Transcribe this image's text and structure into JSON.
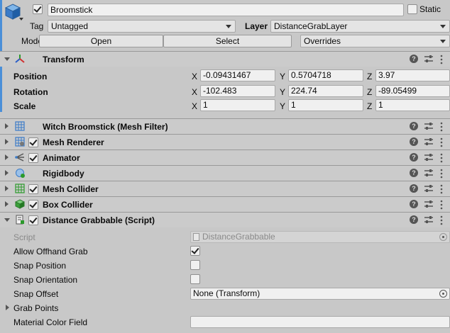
{
  "header": {
    "name": "Broomstick",
    "static_label": "Static",
    "tag_label": "Tag",
    "tag_value": "Untagged",
    "layer_label": "Layer",
    "layer_value": "DistanceGrabLayer",
    "model_label": "Model",
    "open_label": "Open",
    "select_label": "Select",
    "overrides_label": "Overrides"
  },
  "transform": {
    "title": "Transform",
    "rows": [
      {
        "label": "Position",
        "x": "-0.09431467",
        "y": "0.5704718",
        "z": "3.97"
      },
      {
        "label": "Rotation",
        "x": "-102.483",
        "y": "224.74",
        "z": "-89.05499"
      },
      {
        "label": "Scale",
        "x": "1",
        "y": "1",
        "z": "1"
      }
    ],
    "axis_x": "X",
    "axis_y": "Y",
    "axis_z": "Z"
  },
  "components": [
    {
      "title": "Witch Broomstick (Mesh Filter)",
      "icon": "mesh-filter-icon",
      "checkbox": false
    },
    {
      "title": "Mesh Renderer",
      "icon": "mesh-renderer-icon",
      "checkbox": true
    },
    {
      "title": "Animator",
      "icon": "animator-icon",
      "checkbox": true
    },
    {
      "title": "Rigidbody",
      "icon": "rigidbody-icon",
      "checkbox": false
    },
    {
      "title": "Mesh Collider",
      "icon": "mesh-collider-icon",
      "checkbox": true
    },
    {
      "title": "Box Collider",
      "icon": "box-collider-icon",
      "checkbox": true
    },
    {
      "title": "Distance Grabbable (Script)",
      "icon": "script-icon",
      "checkbox": true
    }
  ],
  "script": {
    "script_label": "Script",
    "script_value": "DistanceGrabbable",
    "allow_offhand_label": "Allow Offhand Grab",
    "allow_offhand_checked": true,
    "snap_position_label": "Snap Position",
    "snap_position_checked": false,
    "snap_orientation_label": "Snap Orientation",
    "snap_orientation_checked": false,
    "snap_offset_label": "Snap Offset",
    "snap_offset_value": "None (Transform)",
    "grab_points_label": "Grab Points",
    "material_color_label": "Material Color Field",
    "material_color_value": ""
  },
  "colors": {
    "accent": "#4a8fd8",
    "panel": "#c8c8c8",
    "header": "#cbcbcb"
  }
}
